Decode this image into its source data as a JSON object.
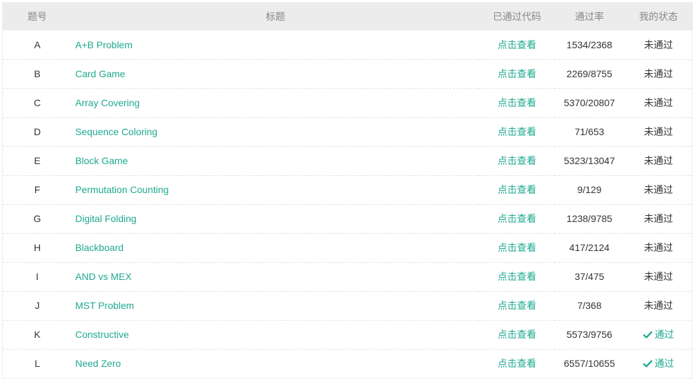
{
  "headers": {
    "id": "题号",
    "title": "标题",
    "code": "已通过代码",
    "rate": "通过率",
    "status": "我的状态"
  },
  "colors": {
    "accent": "#1ea98f",
    "header_bg": "#ececec",
    "header_text": "#888888",
    "text": "#333333"
  },
  "rows": [
    {
      "id": "A",
      "title": "A+B Problem",
      "code": "点击查看",
      "rate": "1534/2368",
      "status": "未通过",
      "passed": false
    },
    {
      "id": "B",
      "title": "Card Game",
      "code": "点击查看",
      "rate": "2269/8755",
      "status": "未通过",
      "passed": false
    },
    {
      "id": "C",
      "title": "Array Covering",
      "code": "点击查看",
      "rate": "5370/20807",
      "status": "未通过",
      "passed": false
    },
    {
      "id": "D",
      "title": "Sequence Coloring",
      "code": "点击查看",
      "rate": "71/653",
      "status": "未通过",
      "passed": false
    },
    {
      "id": "E",
      "title": "Block Game",
      "code": "点击查看",
      "rate": "5323/13047",
      "status": "未通过",
      "passed": false
    },
    {
      "id": "F",
      "title": "Permutation Counting",
      "code": "点击查看",
      "rate": "9/129",
      "status": "未通过",
      "passed": false
    },
    {
      "id": "G",
      "title": "Digital Folding",
      "code": "点击查看",
      "rate": "1238/9785",
      "status": "未通过",
      "passed": false
    },
    {
      "id": "H",
      "title": "Blackboard",
      "code": "点击查看",
      "rate": "417/2124",
      "status": "未通过",
      "passed": false
    },
    {
      "id": "I",
      "title": "AND vs MEX",
      "code": "点击查看",
      "rate": "37/475",
      "status": "未通过",
      "passed": false
    },
    {
      "id": "J",
      "title": "MST Problem",
      "code": "点击查看",
      "rate": "7/368",
      "status": "未通过",
      "passed": false
    },
    {
      "id": "K",
      "title": "Constructive",
      "code": "点击查看",
      "rate": "5573/9756",
      "status": "通过",
      "passed": true
    },
    {
      "id": "L",
      "title": "Need Zero",
      "code": "点击查看",
      "rate": "6557/10655",
      "status": "通过",
      "passed": true
    }
  ]
}
